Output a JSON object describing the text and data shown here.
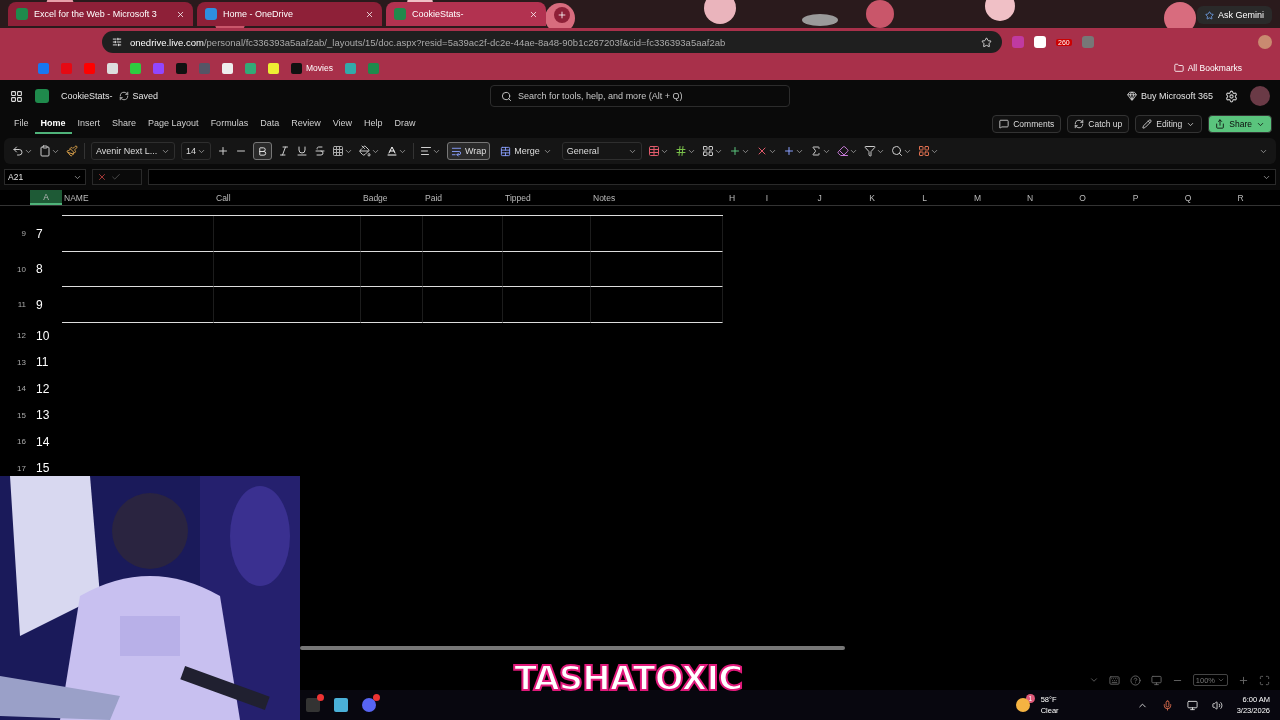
{
  "browser": {
    "tabs": [
      {
        "title": "Excel for the Web - Microsoft 3",
        "kind": "excel",
        "selected": false
      },
      {
        "title": "Home - OneDrive",
        "kind": "onedrive",
        "selected": false
      },
      {
        "title": "CookieStats-",
        "kind": "excel",
        "selected": true
      }
    ],
    "ask_gemini": "Ask Gemini",
    "url_host": "onedrive.live.com",
    "url_path": "/personal/fc336393a5aaf2ab/_layouts/15/doc.aspx?resid=5a39ac2f-dc2e-44ae-8a48-90b1c267203f&cid=fc336393a5aaf2ab",
    "extension_badge": "260",
    "bookmark_label": "Movies",
    "all_bookmarks": "All Bookmarks"
  },
  "excel": {
    "file_name": "CookieStats-",
    "save_status": "Saved",
    "search": {
      "placeholder": "Search for tools, help, and more (Alt + Q)"
    },
    "buy": "Buy Microsoft 365",
    "menu": [
      {
        "label": "File",
        "selected": false
      },
      {
        "label": "Home",
        "selected": true
      },
      {
        "label": "Insert",
        "selected": false
      },
      {
        "label": "Share",
        "selected": false
      },
      {
        "label": "Page Layout",
        "selected": false
      },
      {
        "label": "Formulas",
        "selected": false
      },
      {
        "label": "Data",
        "selected": false
      },
      {
        "label": "Review",
        "selected": false
      },
      {
        "label": "View",
        "selected": false
      },
      {
        "label": "Help",
        "selected": false
      },
      {
        "label": "Draw",
        "selected": false
      }
    ],
    "actions": {
      "comments": "Comments",
      "catch_up": "Catch up",
      "editing": "Editing",
      "share": "Share"
    },
    "ribbon": {
      "font": "Avenir Next L...",
      "size": "14",
      "bold": true,
      "wrap": {
        "label": "Wrap",
        "active": true
      },
      "merge": "Merge",
      "number_format": "General"
    },
    "name_box": "A21",
    "columns": [
      {
        "label": "A",
        "selected": true
      },
      {
        "label": "NAME",
        "selected": false
      },
      {
        "label": "Call",
        "selected": false
      },
      {
        "label": "Badge",
        "selected": false
      },
      {
        "label": "Paid",
        "selected": false
      },
      {
        "label": "Tipped",
        "selected": false
      },
      {
        "label": "Notes",
        "selected": false
      },
      {
        "label": "H",
        "selected": false
      },
      {
        "label": "I",
        "selected": false
      },
      {
        "label": "J",
        "selected": false
      },
      {
        "label": "K",
        "selected": false
      },
      {
        "label": "L",
        "selected": false
      },
      {
        "label": "M",
        "selected": false
      },
      {
        "label": "N",
        "selected": false
      },
      {
        "label": "O",
        "selected": false
      },
      {
        "label": "P",
        "selected": false
      },
      {
        "label": "Q",
        "selected": false
      },
      {
        "label": "R",
        "selected": false
      }
    ],
    "rows": [
      {
        "header": "9",
        "value": "7",
        "kind": "table"
      },
      {
        "header": "10",
        "value": "8",
        "kind": "table"
      },
      {
        "header": "11",
        "value": "9",
        "kind": "table"
      },
      {
        "header": "12",
        "value": "10",
        "kind": "plain"
      },
      {
        "header": "13",
        "value": "11",
        "kind": "plain"
      },
      {
        "header": "14",
        "value": "12",
        "kind": "plain"
      },
      {
        "header": "15",
        "value": "13",
        "kind": "plain"
      },
      {
        "header": "16",
        "value": "14",
        "kind": "plain"
      },
      {
        "header": "17",
        "value": "15",
        "kind": "plain"
      }
    ],
    "zoom": "100%"
  },
  "overlay_title": "TASHATOXIC",
  "taskbar": {
    "weather_badge": "1",
    "temperature": "58°F",
    "condition": "Clear",
    "time": "6:00 AM",
    "date": "3/23/2026"
  }
}
